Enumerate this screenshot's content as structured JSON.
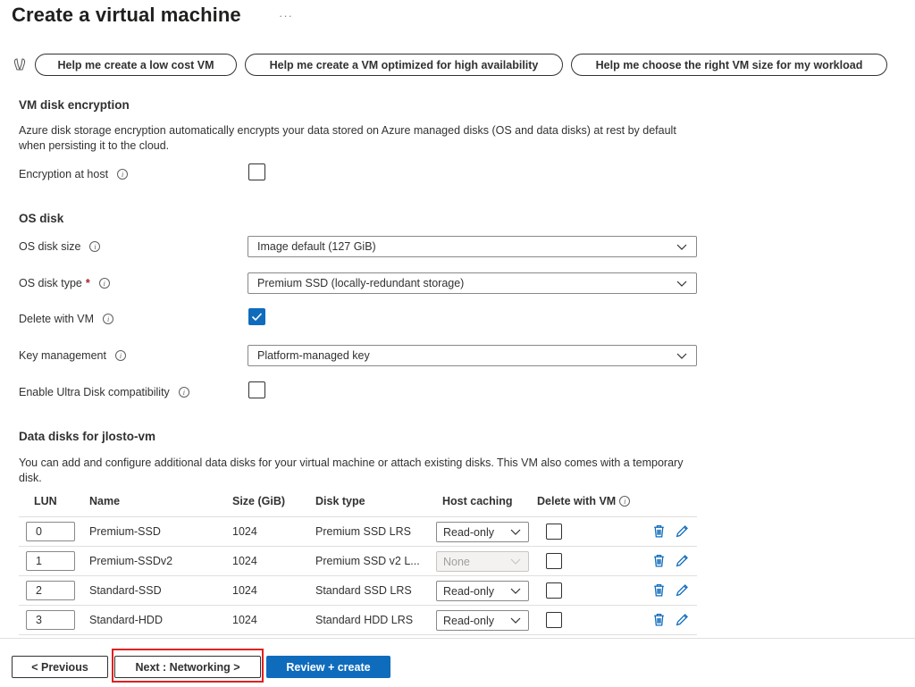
{
  "page": {
    "title": "Create a virtual machine",
    "more_label": "···"
  },
  "assist": {
    "icon": "copilot-icon",
    "buttons": [
      "Help me create a low cost VM",
      "Help me create a VM optimized for high availability",
      "Help me choose the right VM size for my workload"
    ]
  },
  "disk_encryption": {
    "title": "VM disk encryption",
    "description": "Azure disk storage encryption automatically encrypts your data stored on Azure managed disks (OS and data disks) at rest by default when persisting it to the cloud.",
    "encryption_at_host": {
      "label": "Encryption at host",
      "checked": false
    }
  },
  "os_disk": {
    "title": "OS disk",
    "size": {
      "label": "OS disk size",
      "value": "Image default (127 GiB)"
    },
    "type": {
      "label": "OS disk type",
      "required": "*",
      "value": "Premium SSD (locally-redundant storage)"
    },
    "delete_with_vm": {
      "label": "Delete with VM",
      "checked": true
    },
    "key_management": {
      "label": "Key management",
      "value": "Platform-managed key"
    },
    "ultra_disk": {
      "label": "Enable Ultra Disk compatibility",
      "checked": false
    }
  },
  "data_disks": {
    "title": "Data disks for jlosto-vm",
    "description": "You can add and configure additional data disks for your virtual machine or attach existing disks. This VM also comes with a temporary disk.",
    "columns": [
      "LUN",
      "Name",
      "Size (GiB)",
      "Disk type",
      "Host caching",
      "Delete with VM"
    ],
    "rows": [
      {
        "lun": "0",
        "name": "Premium-SSD",
        "size": "1024",
        "type": "Premium SSD LRS",
        "caching": "Read-only",
        "caching_disabled": false,
        "delete": false
      },
      {
        "lun": "1",
        "name": "Premium-SSDv2",
        "size": "1024",
        "type": "Premium SSD v2 L...",
        "caching": "None",
        "caching_disabled": true,
        "delete": false
      },
      {
        "lun": "2",
        "name": "Standard-SSD",
        "size": "1024",
        "type": "Standard SSD LRS",
        "caching": "Read-only",
        "caching_disabled": false,
        "delete": false
      },
      {
        "lun": "3",
        "name": "Standard-HDD",
        "size": "1024",
        "type": "Standard HDD LRS",
        "caching": "Read-only",
        "caching_disabled": false,
        "delete": false
      }
    ]
  },
  "footer": {
    "previous": "< Previous",
    "next": "Next : Networking >",
    "review": "Review + create"
  },
  "colors": {
    "accent": "#0f6cbd",
    "highlight": "#e02020"
  }
}
